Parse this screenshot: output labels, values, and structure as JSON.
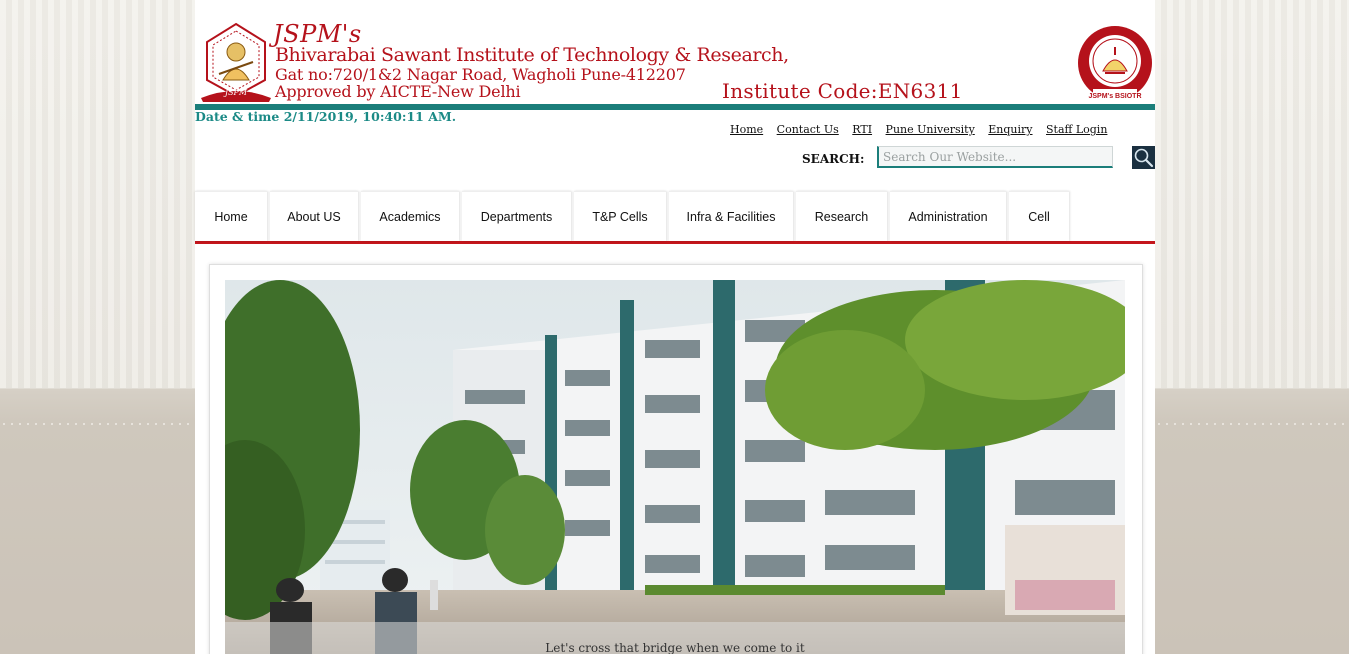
{
  "header": {
    "brand_short": "JSPM's",
    "institute_name": "Bhivarabai Sawant Institute of Technology & Research,",
    "address": "Gat no:720/1&2 Nagar Road, Wagholi Pune-412207",
    "approval": "Approved by AICTE-New Delhi",
    "institute_code": "Institute Code:EN6311",
    "left_logo_text": "JSPM",
    "right_logo_text": "JSPM's BSIOTR",
    "brand_color": "#b5121b",
    "accent_color": "#1b7e7a"
  },
  "datetime": "Date & time 2/11/2019, 10:40:11 AM.",
  "top_links": [
    "Home",
    "Contact Us",
    "RTI",
    "Pune University",
    "Enquiry",
    "Staff Login"
  ],
  "search": {
    "label": "SEARCH:",
    "placeholder": "Search Our Website...",
    "value": ""
  },
  "nav": {
    "items": [
      "Home",
      "About US",
      "Academics",
      "Departments",
      "T&P Cells",
      "Infra & Facilities",
      "Research",
      "Administration",
      "Cell"
    ],
    "underline_color": "#c4161c"
  },
  "slider": {
    "caption": "Let's cross that bridge when we come to it"
  }
}
